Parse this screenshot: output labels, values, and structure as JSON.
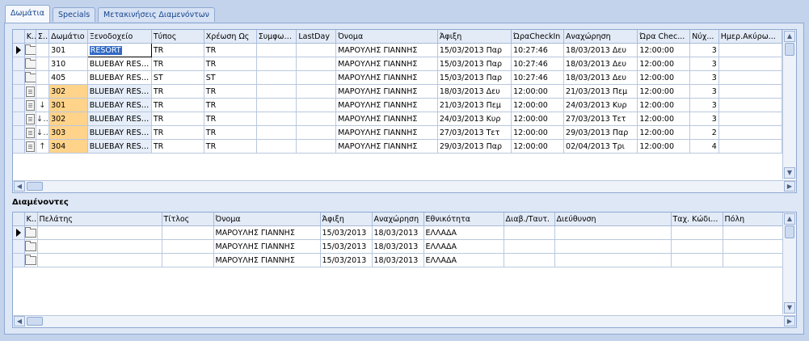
{
  "tabs": [
    {
      "label": "Δωμάτια",
      "active": true
    },
    {
      "label": "Specials",
      "active": false
    },
    {
      "label": "Μετακινήσεις Διαμενόντων",
      "active": false
    }
  ],
  "rooms_grid": {
    "columns": [
      "Κ...",
      "Σ...",
      "Δωμάτιο",
      "Ξενοδοχείο",
      "Τύπος",
      "Χρέωση Ως",
      "Συμφωνία",
      "LastDay",
      "Όνομα",
      "Άφιξη",
      "ΏραCheckIn",
      "Αναχώρηση",
      "Ώρα Chec...",
      "Νύχ...",
      "Ημερ.Ακύρω..."
    ],
    "rows": [
      {
        "k_icon": "folder-icon",
        "s_icon": "",
        "room": "301",
        "hotel": "RESORT",
        "type": "TR",
        "charge": "TR",
        "agreement": "",
        "lastday": "",
        "name": "ΜΑΡΟΥΛΗΣ ΓΙΑΝΝΗΣ",
        "arrival": "15/03/2013 Παρ",
        "checkin": "10:27:46",
        "departure": "18/03/2013 Δευ",
        "checkout": "12:00:00",
        "nights": "3",
        "cancel": "",
        "current": true,
        "highlight": false
      },
      {
        "k_icon": "folder-icon",
        "s_icon": "",
        "room": "310",
        "hotel": "BLUEBAY RESORT",
        "type": "TR",
        "charge": "TR",
        "agreement": "",
        "lastday": "",
        "name": "ΜΑΡΟΥΛΗΣ ΓΙΑΝΝΗΣ",
        "arrival": "15/03/2013 Παρ",
        "checkin": "10:27:46",
        "departure": "18/03/2013 Δευ",
        "checkout": "12:00:00",
        "nights": "3",
        "cancel": "",
        "current": false,
        "highlight": false
      },
      {
        "k_icon": "folder-icon",
        "s_icon": "",
        "room": "405",
        "hotel": "BLUEBAY RESORT",
        "type": "ST",
        "charge": "ST",
        "agreement": "",
        "lastday": "",
        "name": "ΜΑΡΟΥΛΗΣ ΓΙΑΝΝΗΣ",
        "arrival": "15/03/2013 Παρ",
        "checkin": "10:27:46",
        "departure": "18/03/2013 Δευ",
        "checkout": "12:00:00",
        "nights": "3",
        "cancel": "",
        "current": false,
        "highlight": false
      },
      {
        "k_icon": "doc-icon",
        "s_icon": "",
        "room": "302",
        "hotel": "BLUEBAY RESORT",
        "type": "TR",
        "charge": "TR",
        "agreement": "",
        "lastday": "",
        "name": "ΜΑΡΟΥΛΗΣ ΓΙΑΝΝΗΣ",
        "arrival": "18/03/2013 Δευ",
        "checkin": "12:00:00",
        "departure": "21/03/2013 Πεμ",
        "checkout": "12:00:00",
        "nights": "3",
        "cancel": "",
        "current": false,
        "highlight": true
      },
      {
        "k_icon": "doc-icon",
        "s_icon": "↓",
        "room": "301",
        "hotel": "BLUEBAY RESORT",
        "type": "TR",
        "charge": "TR",
        "agreement": "",
        "lastday": "",
        "name": "ΜΑΡΟΥΛΗΣ ΓΙΑΝΝΗΣ",
        "arrival": "21/03/2013 Πεμ",
        "checkin": "12:00:00",
        "departure": "24/03/2013 Κυρ",
        "checkout": "12:00:00",
        "nights": "3",
        "cancel": "",
        "current": false,
        "highlight": true
      },
      {
        "k_icon": "doc-icon",
        "s_icon": "↓↑",
        "room": "302",
        "hotel": "BLUEBAY RESORT",
        "type": "TR",
        "charge": "TR",
        "agreement": "",
        "lastday": "",
        "name": "ΜΑΡΟΥΛΗΣ ΓΙΑΝΝΗΣ",
        "arrival": "24/03/2013 Κυρ",
        "checkin": "12:00:00",
        "departure": "27/03/2013 Τετ",
        "checkout": "12:00:00",
        "nights": "3",
        "cancel": "",
        "current": false,
        "highlight": true
      },
      {
        "k_icon": "doc-icon",
        "s_icon": "↓↑",
        "room": "303",
        "hotel": "BLUEBAY RESORT",
        "type": "TR",
        "charge": "TR",
        "agreement": "",
        "lastday": "",
        "name": "ΜΑΡΟΥΛΗΣ ΓΙΑΝΝΗΣ",
        "arrival": "27/03/2013 Τετ",
        "checkin": "12:00:00",
        "departure": "29/03/2013 Παρ",
        "checkout": "12:00:00",
        "nights": "2",
        "cancel": "",
        "current": false,
        "highlight": true
      },
      {
        "k_icon": "doc-icon",
        "s_icon": "↑",
        "room": "304",
        "hotel": "BLUEBAY RESORT",
        "type": "TR",
        "charge": "TR",
        "agreement": "",
        "lastday": "",
        "name": "ΜΑΡΟΥΛΗΣ ΓΙΑΝΝΗΣ",
        "arrival": "29/03/2013 Παρ",
        "checkin": "12:00:00",
        "departure": "02/04/2013 Τρι",
        "checkout": "12:00:00",
        "nights": "4",
        "cancel": "",
        "current": false,
        "highlight": true
      }
    ]
  },
  "guests_section": {
    "title": "Διαμένοντες",
    "columns": [
      "Κ...",
      "Πελάτης",
      "Τίτλος",
      "Όνομα",
      "Άφιξη",
      "Αναχώρηση",
      "Εθνικότητα",
      "Διαβ./Ταυτ.",
      "Διεύθυνση",
      "Ταχ. Κώδι...",
      "Πόλη"
    ],
    "rows": [
      {
        "client": "",
        "title": "",
        "name": "ΜΑΡΟΥΛΗΣ ΓΙΑΝΝΗΣ",
        "arrival": "15/03/2013",
        "departure": "18/03/2013",
        "nationality": "ΕΛΛΑΔΑ",
        "passport": "",
        "address": "",
        "zip": "",
        "city": "",
        "current": true
      },
      {
        "client": "",
        "title": "",
        "name": "ΜΑΡΟΥΛΗΣ ΓΙΑΝΝΗΣ",
        "arrival": "15/03/2013",
        "departure": "18/03/2013",
        "nationality": "ΕΛΛΑΔΑ",
        "passport": "",
        "address": "",
        "zip": "",
        "city": "",
        "current": false
      },
      {
        "client": "",
        "title": "",
        "name": "ΜΑΡΟΥΛΗΣ ΓΙΑΝΝΗΣ",
        "arrival": "15/03/2013",
        "departure": "18/03/2013",
        "nationality": "ΕΛΛΑΔΑ",
        "passport": "",
        "address": "",
        "zip": "",
        "city": "",
        "current": false
      }
    ]
  }
}
